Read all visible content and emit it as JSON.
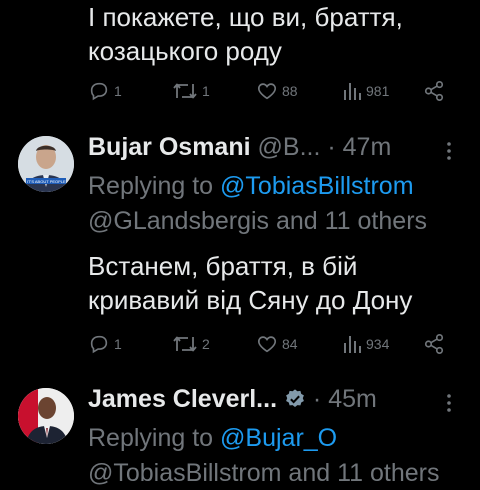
{
  "tweet1": {
    "lines": [
      "І покажете, що ви, браття,",
      "козацького роду"
    ],
    "replies": "1",
    "retweets": "1",
    "likes": "88",
    "views": "981"
  },
  "tweet2": {
    "name": "Bujar Osmani",
    "handle": "@B...",
    "dot": "·",
    "time": "47m",
    "avatar_text": "IT'S ABOUT PEOPLE",
    "replying_prefix": "Replying to ",
    "mention1": "@TobiasBillstrom",
    "mention2": "@GLandsbergis and 11 others",
    "lines": [
      "Встанем, браття, в бій",
      "кривавий від Сяну до Дону"
    ],
    "replies": "1",
    "retweets": "2",
    "likes": "84",
    "views": "934"
  },
  "tweet3": {
    "name": "James Cleverl...",
    "dot": "·",
    "time": "45m",
    "replying_prefix": "Replying to ",
    "mention1": "@Bujar_O",
    "mention2": "@TobiasBillstrom and 11 others"
  },
  "colors": {
    "background": "#000000",
    "text": "#e7e9ea",
    "muted": "#71767b",
    "link": "#1d9bf0",
    "verified": "#829aab"
  }
}
